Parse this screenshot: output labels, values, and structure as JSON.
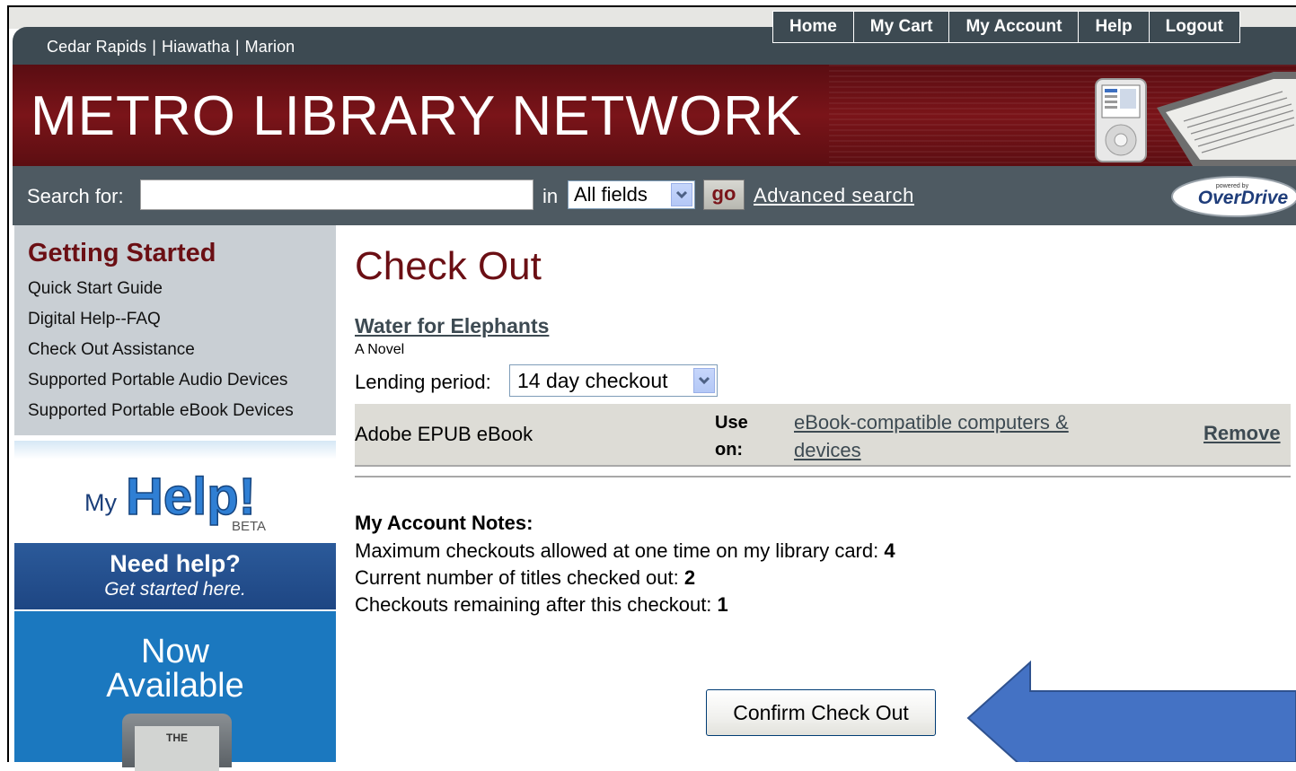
{
  "library_links": [
    "Cedar Rapids",
    "Hiawatha",
    "Marion"
  ],
  "library_separator": "|",
  "nav": {
    "home": "Home",
    "my_cart": "My Cart",
    "my_account": "My Account",
    "help": "Help",
    "logout": "Logout"
  },
  "banner": {
    "title": "METRO LIBRARY NETWORK"
  },
  "search": {
    "label": "Search for:",
    "value": "",
    "in_label": "in",
    "field_selected": "All fields",
    "go_label": "go",
    "advanced_label": "Advanced search",
    "powered_by": "powered by",
    "overdrive_label": "OverDrive"
  },
  "sidebar": {
    "heading": "Getting Started",
    "links": [
      "Quick Start Guide",
      "Digital Help--FAQ",
      "Check Out Assistance",
      "Supported Portable Audio Devices",
      "Supported Portable eBook Devices"
    ],
    "myhelp": {
      "my": "My",
      "help": "Help!",
      "beta": "BETA"
    },
    "needhelp": {
      "title": "Need help?",
      "subtitle": "Get started here."
    },
    "now_available": {
      "line1": "Now",
      "line2": "Available",
      "device_text": "THE"
    }
  },
  "main": {
    "page_title": "Check Out",
    "book_title": "Water for Elephants",
    "book_subtitle": "A Novel",
    "lending_label": "Lending period:",
    "lending_selected": "14 day checkout",
    "format": {
      "name": "Adobe EPUB eBook",
      "use_on_label_1": "Use",
      "use_on_label_2": "on:",
      "compat_line_1": "eBook-compatible computers &",
      "compat_line_2": "devices",
      "remove_label": "Remove"
    },
    "notes": {
      "heading": "My Account Notes:",
      "max_label": "Maximum checkouts allowed at one time on my library card:",
      "max_value": "4",
      "current_label": "Current number of titles checked out:",
      "current_value": "2",
      "remaining_label": "Checkouts remaining after this checkout:",
      "remaining_value": "1"
    },
    "confirm_label": "Confirm Check Out"
  },
  "colors": {
    "maroon": "#6b0f14",
    "slate": "#3d4a52",
    "arrow_blue": "#4472c4"
  }
}
